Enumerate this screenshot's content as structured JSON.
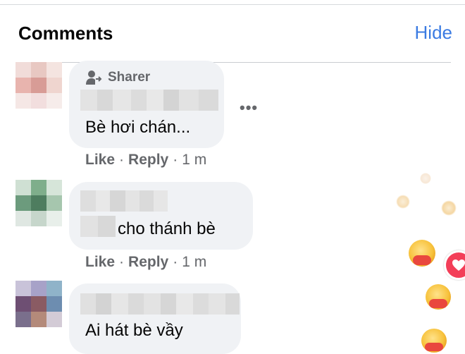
{
  "header": {
    "title": "Comments",
    "hide_label": "Hide"
  },
  "icons": {
    "sharer_icon": "person-share-icon",
    "more_icon": "ellipsis-icon",
    "heart_icon": "heart-icon",
    "reaction_icon": "care-emoji-icon"
  },
  "colors": {
    "link_blue": "#3b7be2",
    "bubble_bg": "#f0f2f5",
    "meta_gray": "#65676b",
    "heart_red": "#f33e58"
  },
  "comments": [
    {
      "badge": "Sharer",
      "text": "Bè hơi chán...",
      "like": "Like",
      "reply": "Reply",
      "time": "1 m",
      "sep": "·"
    },
    {
      "text": "cho thánh bè",
      "like": "Like",
      "reply": "Reply",
      "time": "1 m",
      "sep": "·"
    },
    {
      "text": "Ai hát bè vầy"
    }
  ],
  "more_label": "•••"
}
